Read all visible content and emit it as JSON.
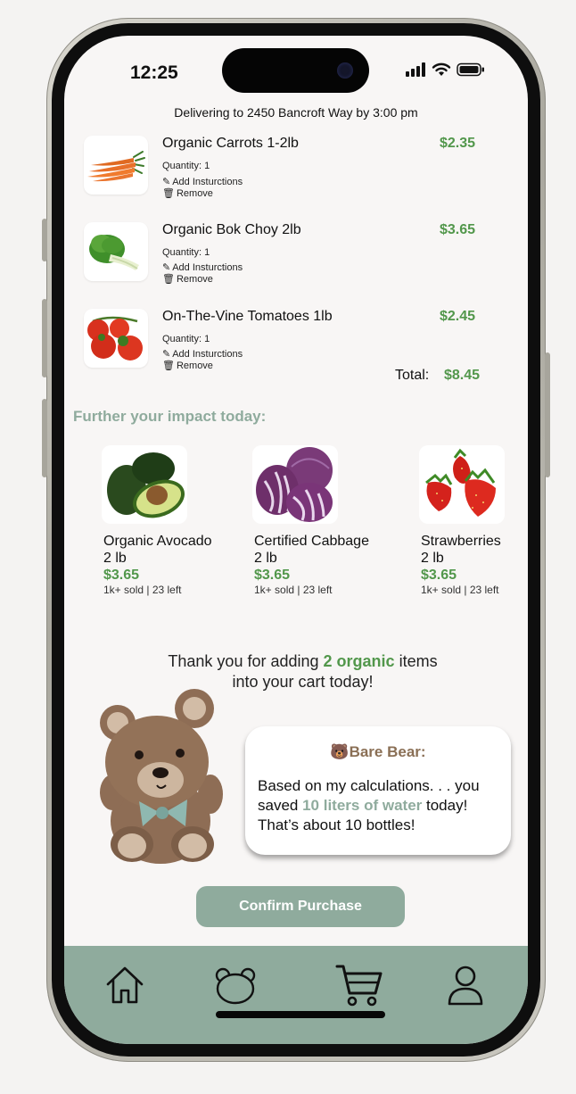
{
  "status_bar": {
    "time": "12:25",
    "icons": [
      "cellular-signal-icon",
      "wifi-icon",
      "battery-icon"
    ]
  },
  "delivery_text": "Delivering to 2450 Bancroft Way by 3:00 pm",
  "cart": {
    "items": [
      {
        "name": "Organic Carrots 1-2lb",
        "quantity": "Quantity: 1",
        "instructions": "Add Insturctions",
        "remove": "Remove",
        "price": "$2.35",
        "image": "carrots-image"
      },
      {
        "name": "Organic Bok Choy 2lb",
        "quantity": "Quantity: 1",
        "instructions": "Add Insturctions",
        "remove": "Remove",
        "price": "$3.65",
        "image": "bok-choy-image"
      },
      {
        "name": "On-The-Vine Tomatoes 1lb",
        "quantity": "Quantity: 1",
        "instructions": "Add Insturctions",
        "remove": "Remove",
        "price": "$2.45",
        "image": "tomatoes-image"
      }
    ],
    "total_label": "Total:",
    "total_value": "$8.45"
  },
  "impact": {
    "title": "Further your impact today:",
    "products": [
      {
        "name_line1": "Organic Avocado",
        "name_line2": "2 lb",
        "price": "$3.65",
        "stats": "1k+ sold | 23 left",
        "image": "avocado-image"
      },
      {
        "name_line1": "Certified Cabbage",
        "name_line2": "2 lb",
        "price": "$3.65",
        "stats": "1k+ sold | 23 left",
        "image": "cabbage-image"
      },
      {
        "name_line1": "Strawberries",
        "name_line2": "2 lb",
        "price": "$3.65",
        "stats": "1k+ sold | 23 left",
        "image": "strawberries-image"
      }
    ]
  },
  "thanks": {
    "prefix": "Thank you for adding ",
    "highlight": "2 organic",
    "suffix": " items",
    "line2": "into your cart today!"
  },
  "bubble": {
    "title_icon": "🐻",
    "title": "Bare Bear:",
    "text_part1": "Based on my calculations. . . you saved ",
    "text_highlight": "10 liters of water",
    "text_part2": " today! That’s about 10 bottles!"
  },
  "confirm_button": "Confirm Purchase",
  "nav": [
    "home-icon",
    "bear-icon",
    "cart-icon",
    "profile-icon"
  ],
  "colors": {
    "accent": "#8fab9d",
    "price": "#52974b",
    "bear_title": "#8a6f55"
  }
}
